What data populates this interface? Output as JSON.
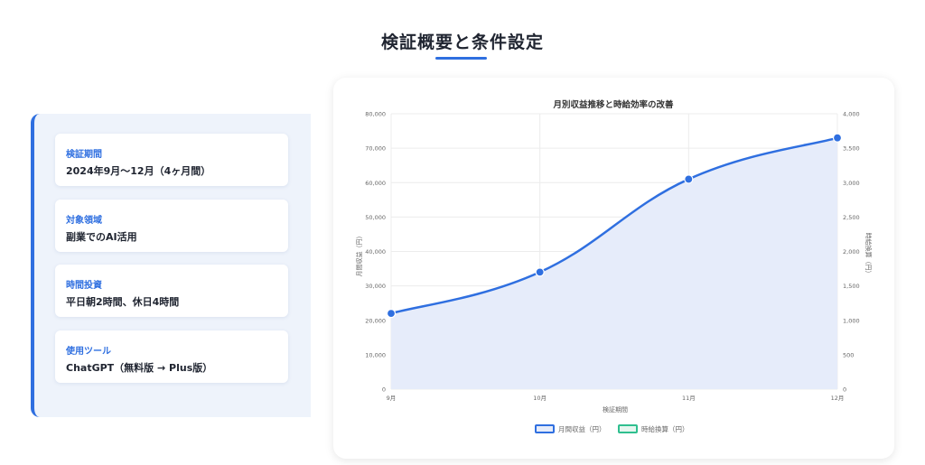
{
  "page": {
    "title": "検証概要と条件設定"
  },
  "info": {
    "items": [
      {
        "label": "検証期間",
        "value": "2024年9月〜12月（4ヶ月間）"
      },
      {
        "label": "対象領域",
        "value": "副業でのAI活用"
      },
      {
        "label": "時間投資",
        "value": "平日朝2時間、休日4時間"
      },
      {
        "label": "使用ツール",
        "value": "ChatGPT（無料版 → Plus版）"
      }
    ]
  },
  "chart_data": {
    "type": "line",
    "title": "月別収益推移と時給効率の改善",
    "xlabel": "検証期間",
    "ylabel_left": "月間収益（円）",
    "ylabel_right": "時給換算（円）",
    "categories": [
      "9月",
      "10月",
      "11月",
      "12月"
    ],
    "ylim_left": [
      0,
      80000
    ],
    "ylim_right": [
      0,
      4000
    ],
    "left_ticks": [
      "0",
      "10,000",
      "20,000",
      "30,000",
      "40,000",
      "50,000",
      "60,000",
      "70,000",
      "80,000"
    ],
    "right_ticks": [
      "0",
      "500",
      "1,000",
      "1,500",
      "2,000",
      "2,500",
      "3,000",
      "3,500",
      "4,000"
    ],
    "grid": true,
    "legend_position": "bottom",
    "series": [
      {
        "name": "月間収益（円）",
        "axis": "left",
        "values": [
          22000,
          34000,
          61000,
          73000
        ],
        "color": "#2f6fe0",
        "fill": "#e6ecfa"
      },
      {
        "name": "時給換算（円）",
        "axis": "right",
        "values": [],
        "color": "#2fbf8f"
      }
    ]
  }
}
